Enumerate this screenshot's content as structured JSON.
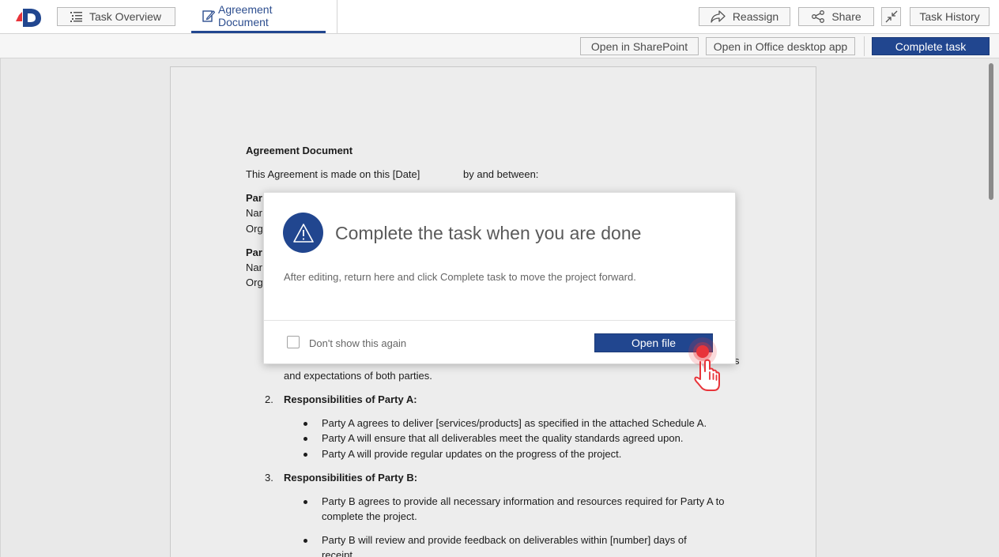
{
  "header": {
    "tabs": [
      {
        "label": "Task Overview",
        "icon": "list-icon"
      },
      {
        "label": "Agreement Document",
        "icon": "edit-document-icon",
        "active": true
      }
    ],
    "buttons": {
      "reassign": "Reassign",
      "share": "Share",
      "history": "Task History"
    }
  },
  "actionbar": {
    "open_sharepoint": "Open in SharePoint",
    "open_office": "Open in Office desktop app",
    "complete_task": "Complete task"
  },
  "document": {
    "title": "Agreement Document",
    "intro_left": "This Agreement is made on this [Date]",
    "intro_right": "by and between:",
    "party_a_heading_visible": "Par",
    "party_a_name_visible": "Nar",
    "party_a_org_visible": "Org",
    "party_b_heading_visible": "Par",
    "party_b_name_visible": "Nar",
    "party_b_org_visible": "Org",
    "section1_tail_end": "s",
    "section1_line2": "and expectations of both parties.",
    "section2_number": "2.",
    "section2_heading": "Responsibilities of Party A:",
    "section2_items": [
      "Party A agrees to deliver [services/products] as specified in the attached Schedule A.",
      "Party A will ensure that all deliverables meet the quality standards agreed upon.",
      "Party A will provide regular updates on the progress of the project."
    ],
    "section3_number": "3.",
    "section3_heading": "Responsibilities of Party B:",
    "section3_item1_line1": "Party B agrees to provide all necessary information and resources required for Party A to",
    "section3_item1_line2": "complete the project.",
    "section3_item2_line1": "Party B will review and provide feedback on deliverables within [number] days of",
    "section3_item2_line2": "receipt."
  },
  "dialog": {
    "title": "Complete the task when you are done",
    "body": "After editing, return here and click Complete task to move the project forward.",
    "checkbox_label": "Don't show this again",
    "checkbox_checked": false,
    "open_button": "Open file",
    "icon": "warning-icon"
  },
  "colors": {
    "brand": "#21468f",
    "cursor_highlight": "#e8343a"
  }
}
